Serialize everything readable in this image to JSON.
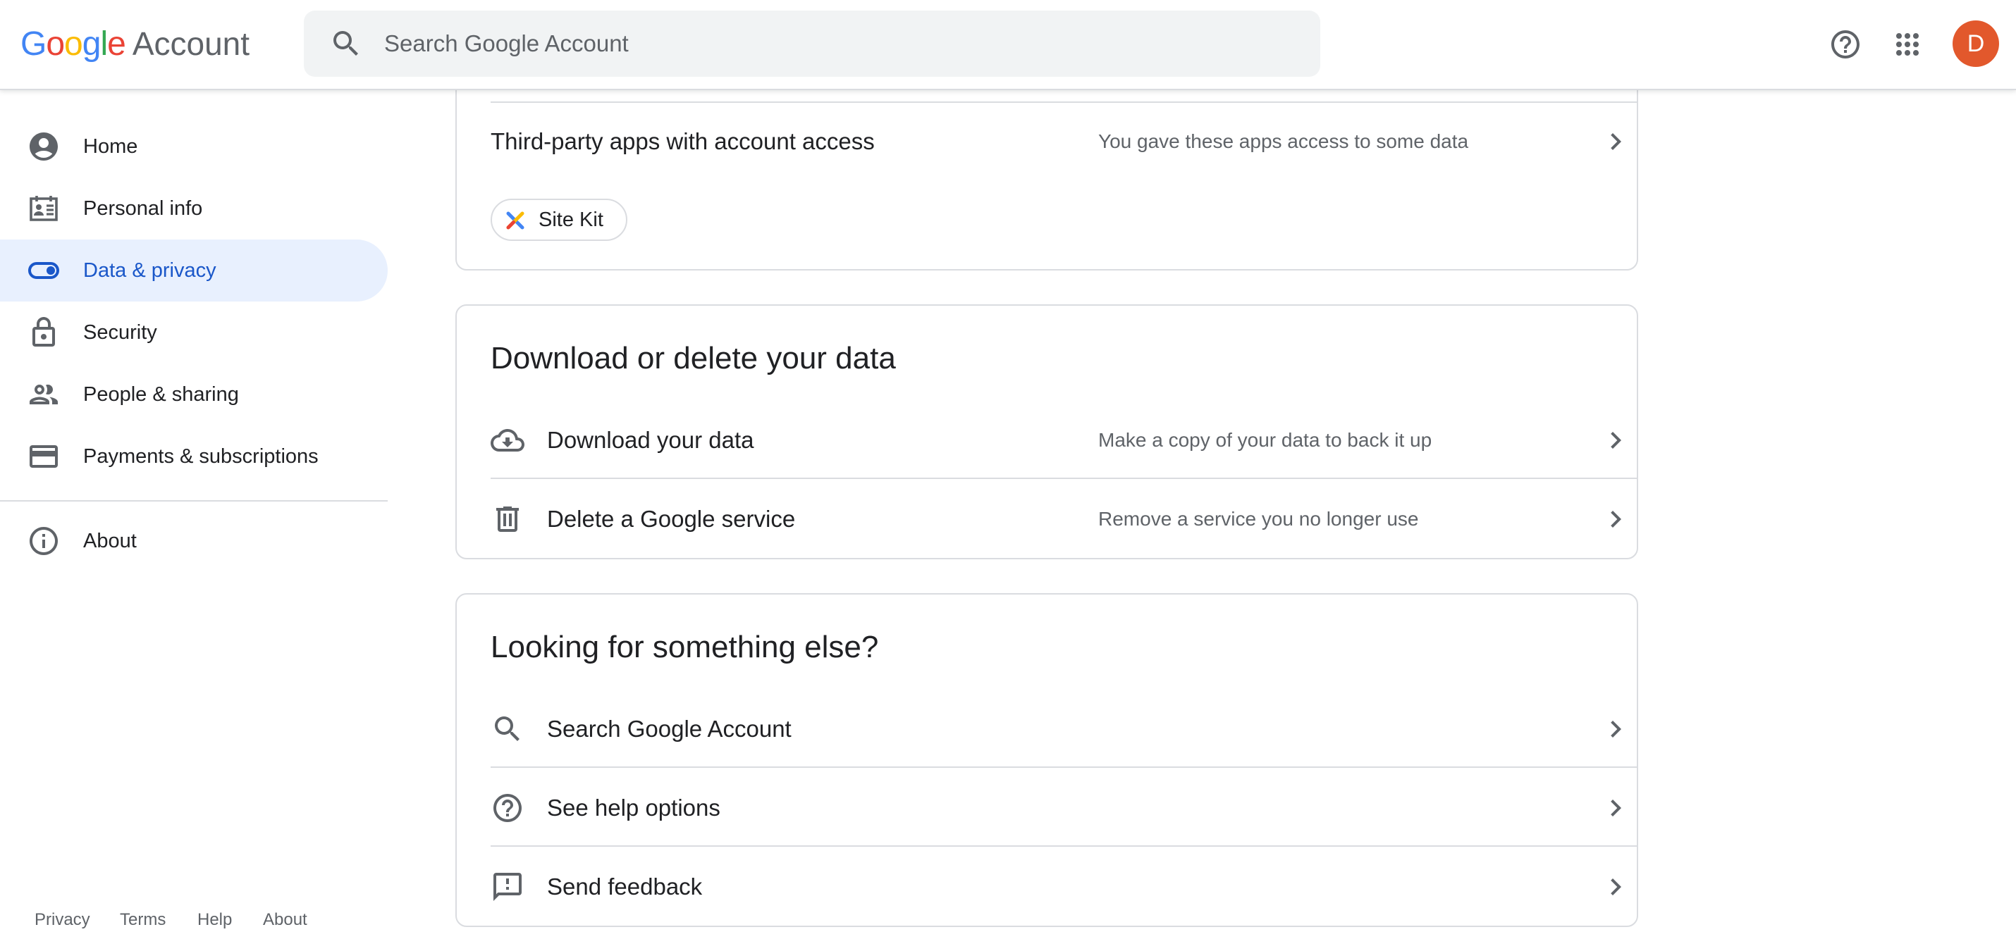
{
  "header": {
    "logo_google": "Google",
    "logo_account": "Account",
    "search_placeholder": "Search Google Account",
    "avatar_initial": "D",
    "icons": [
      "search-icon",
      "help-icon",
      "apps-grid-icon"
    ]
  },
  "sidebar": {
    "items": [
      {
        "label": "Home",
        "icon": "account-circle-icon",
        "active": false
      },
      {
        "label": "Personal info",
        "icon": "id-card-icon",
        "active": false
      },
      {
        "label": "Data & privacy",
        "icon": "toggle-icon",
        "active": true
      },
      {
        "label": "Security",
        "icon": "lock-icon",
        "active": false
      },
      {
        "label": "People & sharing",
        "icon": "people-icon",
        "active": false
      },
      {
        "label": "Payments & subscriptions",
        "icon": "credit-card-icon",
        "active": false
      }
    ],
    "about": {
      "label": "About",
      "icon": "info-icon"
    },
    "footer": [
      "Privacy",
      "Terms",
      "Help",
      "About"
    ]
  },
  "third_party_card": {
    "row_label": "Third-party apps with account access",
    "row_desc": "You gave these apps access to some data",
    "chip_label": "Site Kit"
  },
  "download_card": {
    "title": "Download or delete your data",
    "rows": [
      {
        "label": "Download your data",
        "desc": "Make a copy of your data to back it up",
        "icon": "cloud-download-icon"
      },
      {
        "label": "Delete a Google service",
        "desc": "Remove a service you no longer use",
        "icon": "trash-icon"
      }
    ]
  },
  "looking_card": {
    "title": "Looking for something else?",
    "rows": [
      {
        "label": "Search Google Account",
        "icon": "search-icon"
      },
      {
        "label": "See help options",
        "icon": "help-icon"
      },
      {
        "label": "Send feedback",
        "icon": "feedback-icon"
      }
    ]
  },
  "colors": {
    "accent": "#1a57c9",
    "active_bg": "#e8f0fe",
    "avatar": "#e2582c",
    "google_blue": "#4285f4",
    "google_red": "#ea4335",
    "google_yellow": "#fbbc05",
    "google_green": "#34a853"
  }
}
